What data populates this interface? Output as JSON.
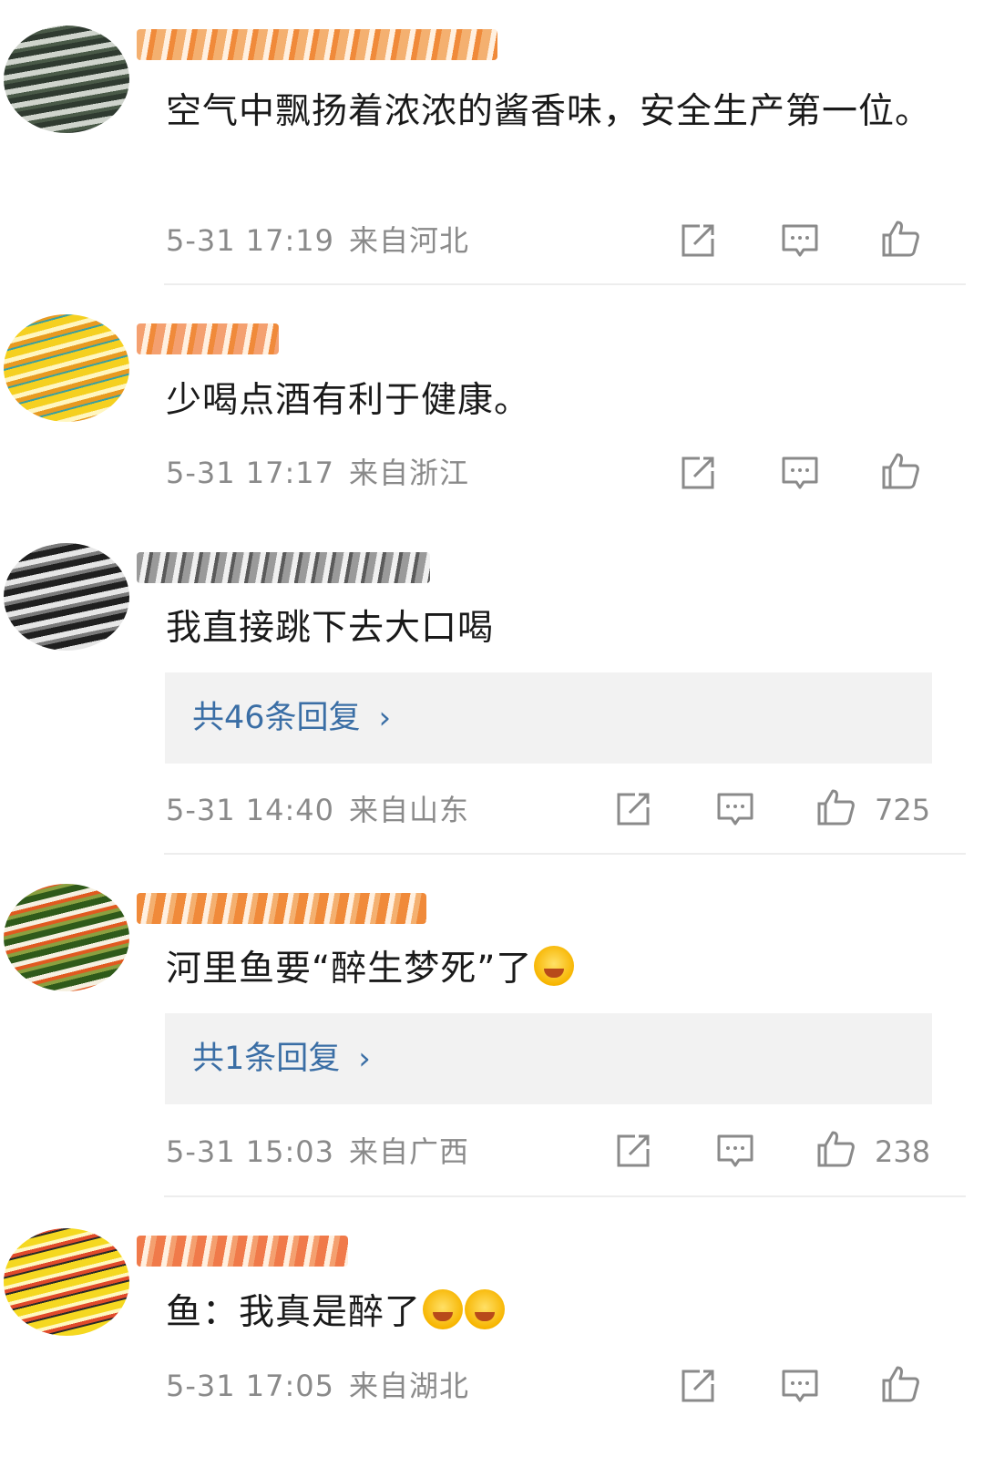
{
  "comments": [
    {
      "text": "空气中飘扬着浓浓的酱香味，安全生产第一位。",
      "time": "5-31 17:19",
      "location": "来自河北",
      "likes": "",
      "reply": "",
      "colors": {
        "avatar": "#5a6a5a",
        "nick": "#f09a4a"
      }
    },
    {
      "text": "少喝点酒有利于健康。",
      "time": "5-31 17:17",
      "location": "来自浙江",
      "likes": "",
      "reply": "",
      "colors": {
        "avatar": "#f2c230",
        "nick": "#f0a060"
      }
    },
    {
      "text": "我直接跳下去大口喝",
      "time": "5-31 14:40",
      "location": "来自山东",
      "likes": "725",
      "reply": "共46条回复",
      "colors": {
        "avatar": "#6a6a6a",
        "nick": "#9a9a9a"
      }
    },
    {
      "text": "河里鱼要“醉生梦死”了",
      "time": "5-31 15:03",
      "location": "来自广西",
      "likes": "238",
      "reply": "共1条回复",
      "emojis": [
        "laugh-cry-emoji"
      ],
      "colors": {
        "avatar": "#6a8a3a",
        "nick": "#f08a3a"
      }
    },
    {
      "text": "鱼：我真是醉了",
      "time": "5-31 17:05",
      "location": "来自湖北",
      "likes": "",
      "reply": "",
      "emojis": [
        "dizzy-emoji",
        "dizzy-emoji"
      ],
      "colors": {
        "avatar": "#f2d020",
        "nick": "#f07a4a"
      }
    }
  ],
  "icons": {
    "share": "share-icon",
    "comment": "comment-icon",
    "like": "thumbs-up-icon",
    "chevron": "chevron-right-icon"
  },
  "colors": {
    "reply_link": "#3a6ea5",
    "meta_gray": "#8a8a8a",
    "reply_bg": "#f2f2f2"
  }
}
